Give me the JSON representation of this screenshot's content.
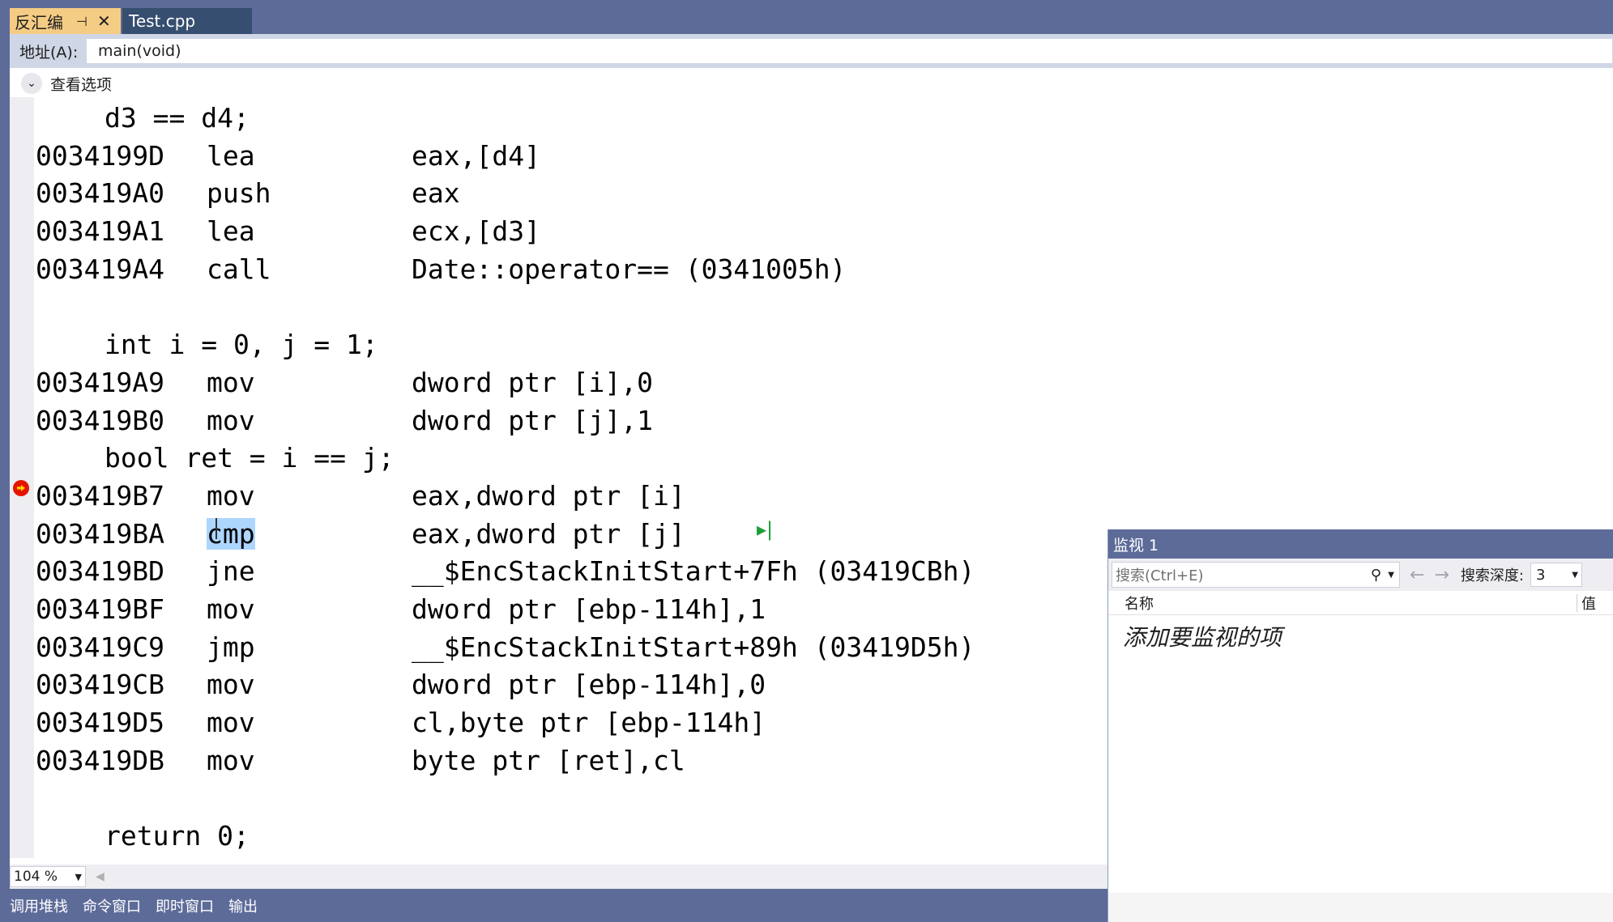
{
  "tabs": {
    "active": {
      "label": "反汇编",
      "pin_icon": "pin-icon",
      "close_icon": "close-icon"
    },
    "inactive": {
      "label": "Test.cpp"
    }
  },
  "address": {
    "label": "地址(A):",
    "value": "main(void)"
  },
  "view_options": {
    "label": "查看选项"
  },
  "code_lines": [
    {
      "type": "src",
      "text": "d3 == d4;"
    },
    {
      "type": "asm",
      "addr": "0034199D",
      "op": "lea",
      "args": "eax,[d4]"
    },
    {
      "type": "asm",
      "addr": "003419A0",
      "op": "push",
      "args": "eax"
    },
    {
      "type": "asm",
      "addr": "003419A1",
      "op": "lea",
      "args": "ecx,[d3]"
    },
    {
      "type": "asm",
      "addr": "003419A4",
      "op": "call",
      "args": "Date::operator== (0341005h)"
    },
    {
      "type": "blank"
    },
    {
      "type": "src",
      "text": "int i = 0, j = 1;"
    },
    {
      "type": "asm",
      "addr": "003419A9",
      "op": "mov",
      "args": "dword ptr [i],0"
    },
    {
      "type": "asm",
      "addr": "003419B0",
      "op": "mov",
      "args": "dword ptr [j],1"
    },
    {
      "type": "src",
      "text": "bool ret = i == j;"
    },
    {
      "type": "asm",
      "addr": "003419B7",
      "op": "mov",
      "args": "eax,dword ptr [i]",
      "breakpoint": true
    },
    {
      "type": "asm",
      "addr": "003419BA",
      "op": "cmp",
      "args": "eax,dword ptr [j]",
      "highlight": true,
      "run_to_click": true
    },
    {
      "type": "asm",
      "addr": "003419BD",
      "op": "jne",
      "args": "__$EncStackInitStart+7Fh (03419CBh)"
    },
    {
      "type": "asm",
      "addr": "003419BF",
      "op": "mov",
      "args": "dword ptr [ebp-114h],1"
    },
    {
      "type": "asm",
      "addr": "003419C9",
      "op": "jmp",
      "args": "__$EncStackInitStart+89h (03419D5h)"
    },
    {
      "type": "asm",
      "addr": "003419CB",
      "op": "mov",
      "args": "dword ptr [ebp-114h],0"
    },
    {
      "type": "asm",
      "addr": "003419D5",
      "op": "mov",
      "args": "cl,byte ptr [ebp-114h]"
    },
    {
      "type": "asm",
      "addr": "003419DB",
      "op": "mov",
      "args": "byte ptr [ret],cl"
    },
    {
      "type": "blank"
    },
    {
      "type": "src",
      "text": "return 0;"
    }
  ],
  "zoom": {
    "value": "104 %"
  },
  "bottom_tabs": [
    "调用堆栈",
    "命令窗口",
    "即时窗口",
    "输出"
  ],
  "watch": {
    "title": "监视 1",
    "search_placeholder": "搜索(Ctrl+E)",
    "depth_label": "搜索深度:",
    "depth_value": "3",
    "col_name": "名称",
    "col_value": "值",
    "add_item": "添加要监视的项"
  },
  "colors": {
    "accent_tab": "#f5cc84",
    "frame": "#5d6b99",
    "highlight": "#add6ff",
    "breakpoint": "#e51400"
  }
}
